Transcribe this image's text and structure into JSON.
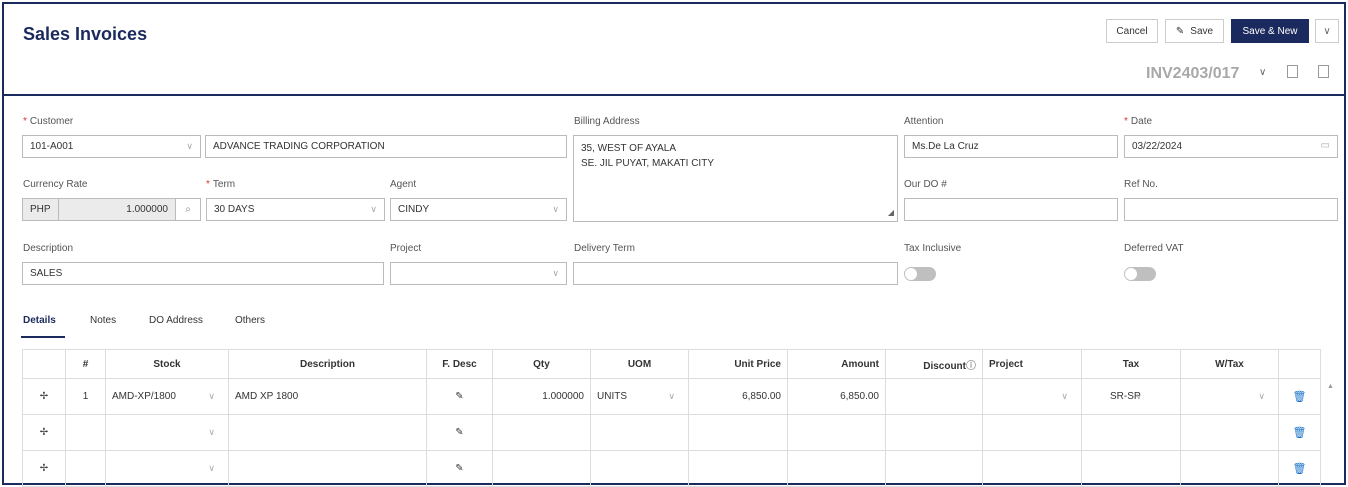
{
  "page": {
    "title": "Sales Invoices",
    "doc_no": "INV2403/017"
  },
  "toolbar": {
    "cancel": "Cancel",
    "save": "Save",
    "save_new": "Save & New"
  },
  "form": {
    "customer_label": "Customer",
    "customer_code": "101-A001",
    "customer_name": "ADVANCE TRADING CORPORATION",
    "billing_label": "Billing Address",
    "billing_line1": "35, WEST OF AYALA",
    "billing_line2": "SE. JIL PUYAT, MAKATI CITY",
    "attention_label": "Attention",
    "attention": "Ms.De La Cruz",
    "date_label": "Date",
    "date": "03/22/2024",
    "currency_label": "Currency Rate",
    "currency": "PHP",
    "rate": "1.000000",
    "term_label": "Term",
    "term": "30 DAYS",
    "agent_label": "Agent",
    "agent": "CINDY",
    "our_do_label": "Our DO #",
    "ref_label": "Ref No.",
    "desc_label": "Description",
    "desc": "SALES",
    "project_label": "Project",
    "delivery_label": "Delivery Term",
    "tax_incl_label": "Tax Inclusive",
    "deferred_label": "Deferred VAT",
    "tax_inclusive_on": false,
    "deferred_vat_on": false
  },
  "tabs": [
    "Details",
    "Notes",
    "DO Address",
    "Others"
  ],
  "table": {
    "headers": [
      "",
      "#",
      "Stock",
      "Description",
      "F. Desc",
      "Qty",
      "UOM",
      "Unit Price",
      "Amount",
      "Discount",
      "Project",
      "Tax",
      "W/Tax",
      ""
    ],
    "row1": {
      "no": "1",
      "stock": "AMD-XP/1800",
      "desc": "AMD XP 1800",
      "qty": "1.000000",
      "uom": "UNITS",
      "unit_price": "6,850.00",
      "amount": "6,850.00",
      "tax": "SR-SP"
    }
  },
  "icons": {
    "drag": "✢",
    "pencil": "✎",
    "trash": "🗑",
    "chevron": "∨",
    "search": "⌕"
  },
  "colors": {
    "primary": "#1b2a5e",
    "required": "#d33",
    "trash": "#1a73c8"
  }
}
